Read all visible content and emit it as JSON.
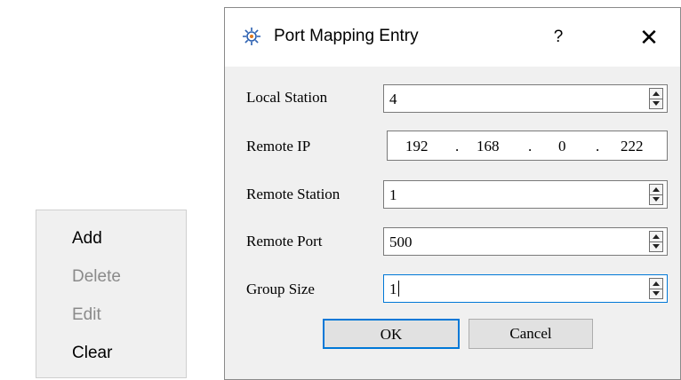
{
  "context_menu": {
    "items": [
      {
        "label": "Add",
        "enabled": true
      },
      {
        "label": "Delete",
        "enabled": false
      },
      {
        "label": "Edit",
        "enabled": false
      },
      {
        "label": "Clear",
        "enabled": true
      }
    ]
  },
  "dialog": {
    "title": "Port Mapping Entry",
    "title_icon": "gear-icon",
    "help_label": "?",
    "close_label": "✕",
    "fields": {
      "local_station": {
        "label": "Local Station",
        "value": "4"
      },
      "remote_ip": {
        "label": "Remote IP",
        "octets": [
          "192",
          "168",
          "0",
          "222"
        ],
        "separator": "."
      },
      "remote_station": {
        "label": "Remote Station",
        "value": "1"
      },
      "remote_port": {
        "label": "Remote Port",
        "value": "500"
      },
      "group_size": {
        "label": "Group Size",
        "value": "1"
      }
    },
    "buttons": {
      "ok": "OK",
      "cancel": "Cancel"
    }
  },
  "colors": {
    "focus": "#0078d7",
    "disabled_text": "#8a8a8a",
    "dialog_bg": "#f0f0f0"
  }
}
